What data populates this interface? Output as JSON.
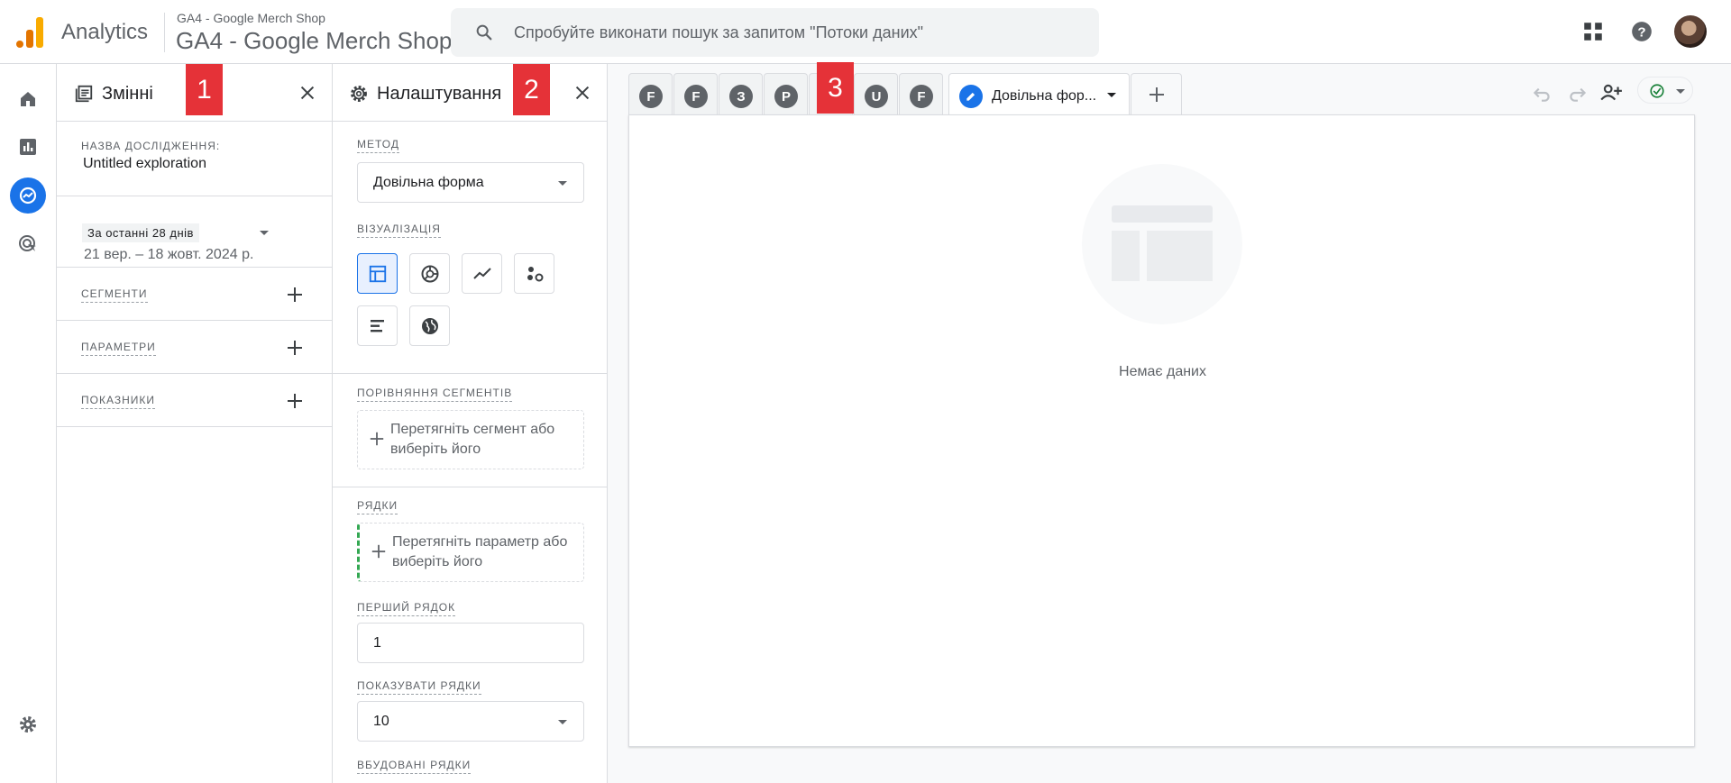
{
  "header": {
    "app_name": "Analytics",
    "account_small": "GA4 - Google Merch Shop",
    "account_big": "GA4 - Google Merch Shop",
    "search_placeholder": "Спробуйте виконати пошук за запитом \"Потоки даних\"",
    "icons": [
      "search-icon",
      "apps-grid-icon",
      "help-icon",
      "avatar"
    ]
  },
  "nav_rail": {
    "items": [
      "home-icon",
      "reports-icon",
      "explore-icon",
      "advertising-icon"
    ],
    "footer": "settings-icon",
    "active": "explore-icon"
  },
  "variables_panel": {
    "title": "Змінні",
    "badge": "1",
    "exploration_label": "НАЗВА ДОСЛІДЖЕННЯ:",
    "exploration_name": "Untitled exploration",
    "date_chip": "За останні 28 днів",
    "date_range": "21 вер. – 18 жовт. 2024 р.",
    "sections": [
      {
        "label": "СЕГМЕНТИ"
      },
      {
        "label": "ПАРАМЕТРИ"
      },
      {
        "label": "ПОКАЗНИКИ"
      }
    ]
  },
  "settings_panel": {
    "title": "Налаштування",
    "badge": "2",
    "method_label": "МЕТОД",
    "method_value": "Довільна форма",
    "viz_label": "ВІЗУАЛІЗАЦІЯ",
    "viz_options": [
      "table-icon",
      "donut-chart-icon",
      "line-chart-icon",
      "scatter-chart-icon",
      "bar-chart-icon",
      "geo-map-icon"
    ],
    "segment_compare_label": "ПОРІВНЯННЯ СЕГМЕНТІВ",
    "segment_drop_text": "Перетягніть сегмент або виберіть його",
    "rows_label": "РЯДКИ",
    "rows_drop_text": "Перетягніть параметр або виберіть його",
    "first_row_label": "ПЕРШИЙ РЯДОК",
    "first_row_value": "1",
    "show_rows_label": "ПОКАЗУВАТИ РЯДКИ",
    "show_rows_value": "10",
    "nested_rows_label": "ВБУДОВАНІ РЯДКИ"
  },
  "tabs": {
    "badge": "3",
    "items": [
      {
        "letter": "F"
      },
      {
        "letter": "F"
      },
      {
        "letter": "З"
      },
      {
        "letter": "P"
      },
      {
        "letter": ""
      },
      {
        "letter": "U"
      },
      {
        "letter": "F"
      }
    ],
    "active_title": "Довільна фор...",
    "add_label": "+"
  },
  "canvas": {
    "empty_text": "Немає даних"
  },
  "colors": {
    "accent": "#1a73e8",
    "badge_red": "#e53238",
    "logo_orange": "#f9ab00",
    "logo_dark_orange": "#e37400",
    "success_green": "#188038"
  }
}
